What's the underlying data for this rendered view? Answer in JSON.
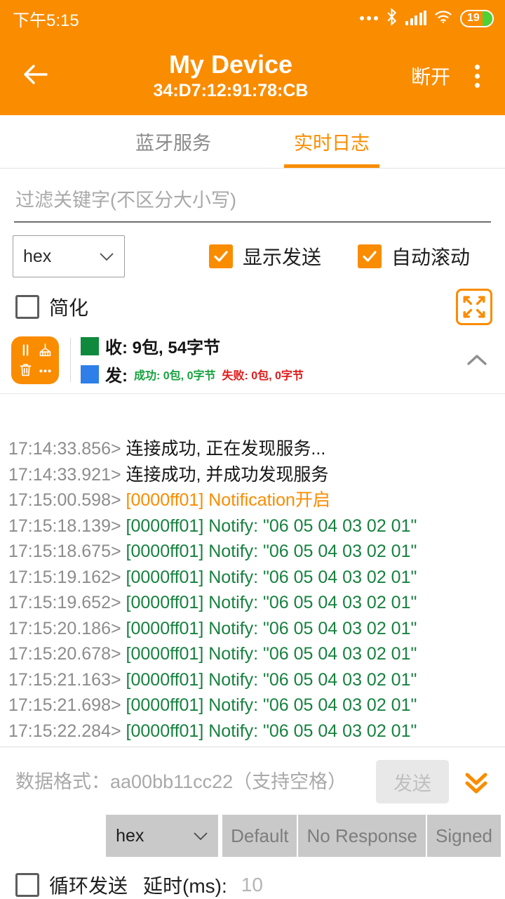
{
  "status_bar": {
    "time": "下午5:15",
    "battery_percent": "19",
    "icons": [
      "more-dots-icon",
      "bluetooth-icon",
      "signal-icon",
      "wifi-icon",
      "battery-icon"
    ]
  },
  "app_bar": {
    "back_icon": "back-arrow-icon",
    "title": "My Device",
    "subtitle": "34:D7:12:91:78:CB",
    "disconnect_label": "断开",
    "overflow_icon": "overflow-menu-icon"
  },
  "tabs": [
    {
      "label": "蓝牙服务",
      "active": false
    },
    {
      "label": "实时日志",
      "active": true
    }
  ],
  "filter": {
    "placeholder": "过滤关键字(不区分大小写)",
    "value": ""
  },
  "controls": {
    "format_select": {
      "value": "hex"
    },
    "show_send": {
      "label": "显示发送",
      "checked": true
    },
    "auto_scroll": {
      "label": "自动滚动",
      "checked": true
    },
    "simplify": {
      "label": "简化",
      "checked": false
    },
    "expand_icon": "fullscreen-expand-icon"
  },
  "stats": {
    "tool_button_icons": [
      "pause-icon",
      "broom-icon",
      "trash-icon",
      "ellipsis-icon"
    ],
    "rx": {
      "swatch_color": "#0F8A3C",
      "text": "收: 9包, 54字节"
    },
    "tx": {
      "swatch_color": "#2E7FE8",
      "prefix": "发: ",
      "success": "成功: 0包, 0字节",
      "fail": "失败: 0包, 0字节"
    },
    "collapse_icon": "chevron-up-icon"
  },
  "log_lines": [
    {
      "ts": "17:14:33.856>",
      "msg": "连接成功, 正在发现服务...",
      "color": "plain"
    },
    {
      "ts": "17:14:33.921>",
      "msg": "连接成功, 并成功发现服务",
      "color": "plain"
    },
    {
      "ts": "17:15:00.598>",
      "msg": "[0000ff01] Notification开启",
      "color": "orange"
    },
    {
      "ts": "17:15:18.139>",
      "msg": "[0000ff01] Notify: \"06 05 04 03 02 01\"",
      "color": "green"
    },
    {
      "ts": "17:15:18.675>",
      "msg": "[0000ff01] Notify: \"06 05 04 03 02 01\"",
      "color": "green"
    },
    {
      "ts": "17:15:19.162>",
      "msg": "[0000ff01] Notify: \"06 05 04 03 02 01\"",
      "color": "green"
    },
    {
      "ts": "17:15:19.652>",
      "msg": "[0000ff01] Notify: \"06 05 04 03 02 01\"",
      "color": "green"
    },
    {
      "ts": "17:15:20.186>",
      "msg": "[0000ff01] Notify: \"06 05 04 03 02 01\"",
      "color": "green"
    },
    {
      "ts": "17:15:20.678>",
      "msg": "[0000ff01] Notify: \"06 05 04 03 02 01\"",
      "color": "green"
    },
    {
      "ts": "17:15:21.163>",
      "msg": "[0000ff01] Notify: \"06 05 04 03 02 01\"",
      "color": "green"
    },
    {
      "ts": "17:15:21.698>",
      "msg": "[0000ff01] Notify: \"06 05 04 03 02 01\"",
      "color": "green"
    },
    {
      "ts": "17:15:22.284>",
      "msg": "[0000ff01] Notify: \"06 05 04 03 02 01\"",
      "color": "green"
    }
  ],
  "send": {
    "placeholder": "数据格式：aa00bb11cc22（支持空格）",
    "value": "",
    "button_label": "发送",
    "scroll_down_icon": "double-chevron-down-icon"
  },
  "write_options": {
    "format_select": {
      "value": "hex"
    },
    "segments": [
      "Default",
      "No Response",
      "Signed"
    ]
  },
  "loop": {
    "label": "循环发送",
    "checked": false,
    "delay_label": "延时(ms):",
    "delay_value": "",
    "delay_placeholder": "10"
  },
  "colors": {
    "accent": "#FA8C00",
    "rx_green": "#0F8A3C",
    "tx_blue": "#2E7FE8",
    "log_green": "#17813F",
    "fail_red": "#E01A1A"
  }
}
